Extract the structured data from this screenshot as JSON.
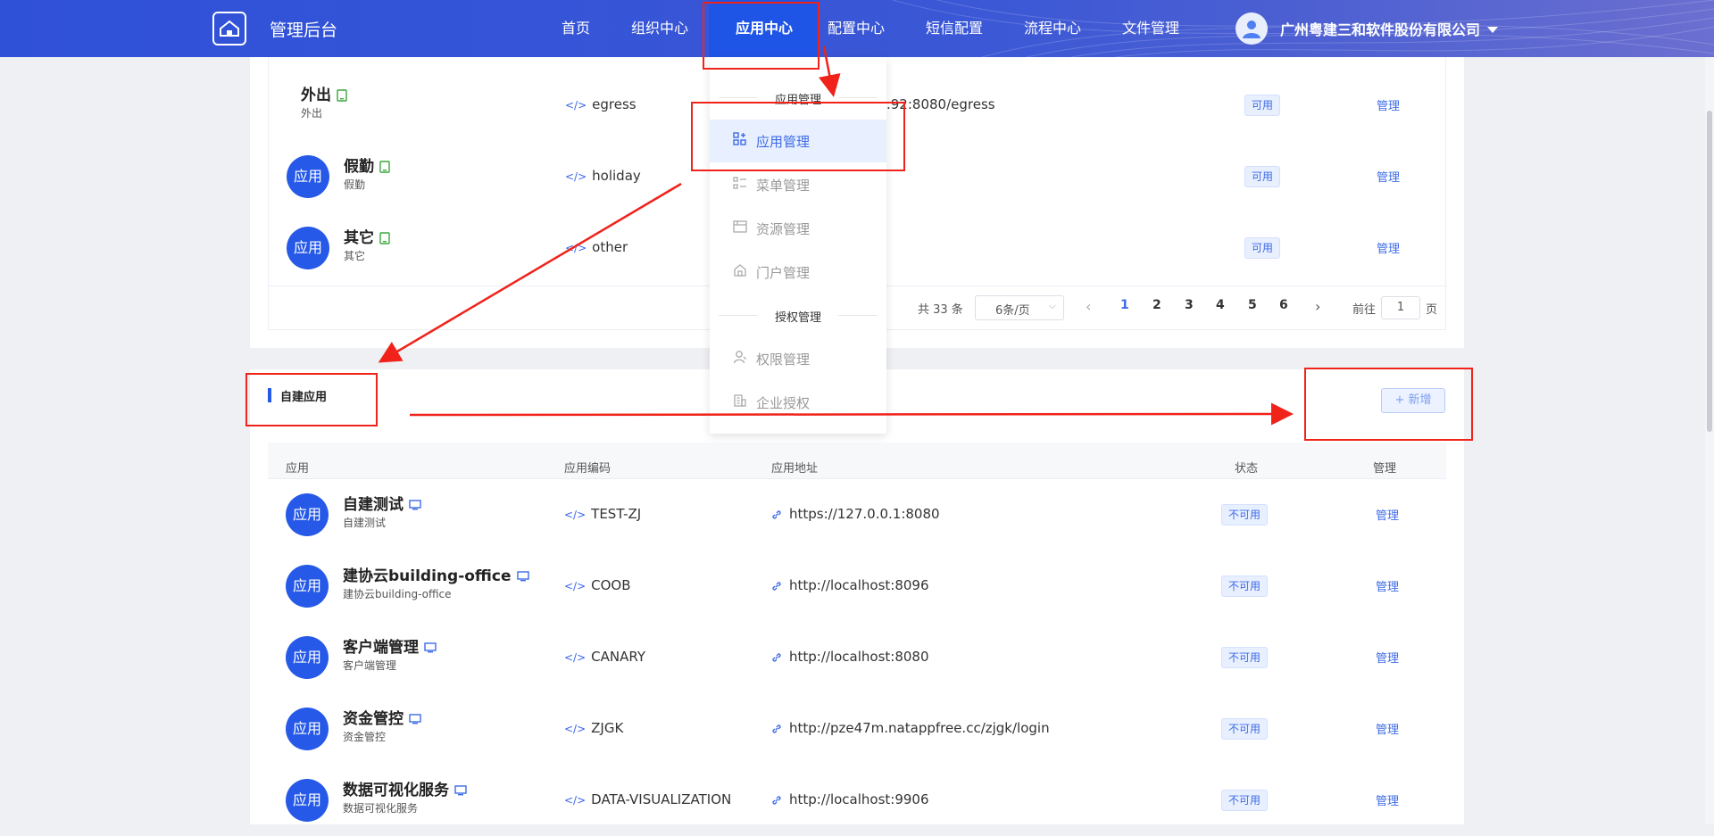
{
  "header": {
    "brand": "管理后台",
    "nav": [
      "首页",
      "组织中心",
      "应用中心",
      "配置中心",
      "短信配置",
      "流程中心",
      "文件管理"
    ],
    "active_nav": "应用中心",
    "company": "广州粤建三和软件股份有限公司"
  },
  "top_table": {
    "rows": [
      {
        "name": "外出",
        "sub": "外出",
        "code": "egress",
        "url": ".92:8080/egress",
        "status": "可用",
        "manage": "管理"
      },
      {
        "avatar": "应用",
        "name": "假勤",
        "sub": "假勤",
        "code": "holiday",
        "status": "可用",
        "manage": "管理"
      },
      {
        "avatar": "应用",
        "name": "其它",
        "sub": "其它",
        "code": "other",
        "status": "可用",
        "manage": "管理"
      }
    ],
    "pagination": {
      "total": "共 33 条",
      "page_size": "6条/页",
      "pages": [
        "1",
        "2",
        "3",
        "4",
        "5",
        "6"
      ],
      "current": "1",
      "goto_label": "前往",
      "goto_value": "1",
      "page_suffix": "页"
    }
  },
  "self_built": {
    "title": "自建应用",
    "add_button": "+ 新增",
    "columns": [
      "应用",
      "应用编码",
      "应用地址",
      "状态",
      "管理"
    ],
    "rows": [
      {
        "avatar": "应用",
        "name": "自建测试",
        "sub": "自建测试",
        "code": "TEST-ZJ",
        "url": "https://127.0.0.1:8080",
        "status": "不可用",
        "manage": "管理"
      },
      {
        "avatar": "应用",
        "name": "建协云building-office",
        "sub": "建协云building-office",
        "code": "COOB",
        "url": "http://localhost:8096",
        "status": "不可用",
        "manage": "管理"
      },
      {
        "avatar": "应用",
        "name": "客户端管理",
        "sub": "客户端管理",
        "code": "CANARY",
        "url": "http://localhost:8080",
        "status": "不可用",
        "manage": "管理"
      },
      {
        "avatar": "应用",
        "name": "资金管控",
        "sub": "资金管控",
        "code": "ZJGK",
        "url": "http://pze47m.natappfree.cc/zjgk/login",
        "status": "不可用",
        "manage": "管理"
      },
      {
        "avatar": "应用",
        "name": "数据可视化服务",
        "sub": "数据可视化服务",
        "code": "DATA-VISUALIZATION",
        "url": "http://localhost:9906",
        "status": "不可用",
        "manage": "管理"
      }
    ]
  },
  "dropdown": {
    "group1": "应用管理",
    "items1": [
      "应用管理",
      "菜单管理",
      "资源管理",
      "门户管理"
    ],
    "group2": "授权管理",
    "items2": [
      "权限管理",
      "企业授权"
    ],
    "selected": "应用管理"
  },
  "colors": {
    "header_blue": "#2f51d8",
    "active_nav": "#1f55e6",
    "avatar_blue": "#2659e8",
    "link_blue": "#3d6be6",
    "annotation_red": "#f0221a"
  }
}
